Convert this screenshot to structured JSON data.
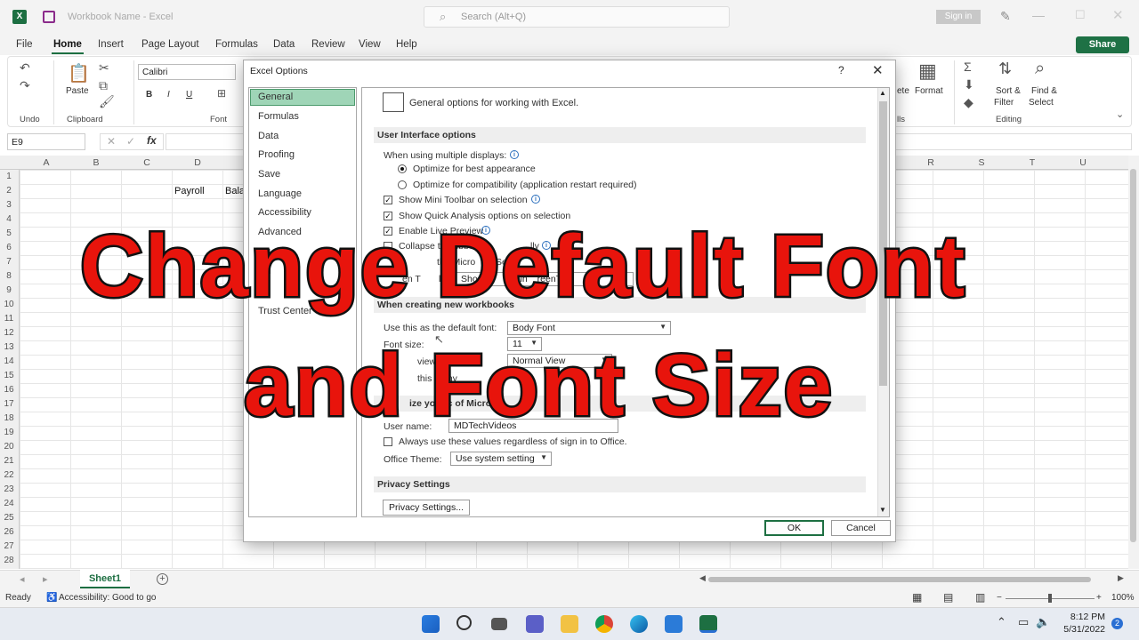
{
  "titlebar": {
    "title": "Workbook Name  -  Excel",
    "search_placeholder": "Search (Alt+Q)",
    "sign_in": "Sign in"
  },
  "menu": [
    "File",
    "Home",
    "Insert",
    "Page Layout",
    "Formulas",
    "Data",
    "Review",
    "View",
    "Help"
  ],
  "share": "Share",
  "ribbon": {
    "undo_label": "Undo",
    "clipboard_label": "Clipboard",
    "paste_label": "Paste",
    "font_label": "Font",
    "font_name": "Calibri",
    "bold": "B",
    "italic": "I",
    "underline": "U",
    "format_label": "Format",
    "sort_label": "Sort &\nFilter",
    "sort_l1": "Sort &",
    "sort_l2": "Filter",
    "find_l1": "Find &",
    "find_l2": "Select",
    "editing_label": "Editing",
    "cells_label_partial": "lls",
    "delete_partial": "ete"
  },
  "formula_bar": {
    "name_box": "E9",
    "fx": "fx"
  },
  "columns": [
    "A",
    "B",
    "C",
    "D",
    "R",
    "S",
    "T",
    "U"
  ],
  "rows": [
    "1",
    "2",
    "3",
    "4",
    "5",
    "6",
    "7",
    "8",
    "9",
    "10",
    "11",
    "12",
    "13",
    "14",
    "15",
    "16",
    "17",
    "18",
    "19",
    "20",
    "21",
    "22",
    "23",
    "24",
    "25",
    "26",
    "27",
    "28"
  ],
  "cells": {
    "payroll": "Payroll",
    "bala": "Bala"
  },
  "sheet_tab": "Sheet1",
  "status": {
    "ready": "Ready",
    "accessibility": "Accessibility: Good to go",
    "zoom": "100%"
  },
  "taskbar": {
    "time": "8:12 PM",
    "date": "5/31/2022",
    "badge": "2"
  },
  "dialog": {
    "title": "Excel Options",
    "help": "?",
    "nav": [
      "General",
      "Formulas",
      "Data",
      "Proofing",
      "Save",
      "Language",
      "Accessibility",
      "Advanced",
      "Customize Ribbon",
      "Quick Access Toolbar",
      "Add-ins",
      "Trust Center"
    ],
    "nav_visible": {
      "ribbon_partial": "Cu",
      "qat_partial": "Qu",
      "addins_partial": "A"
    },
    "header": "General options for working with Excel.",
    "sections": {
      "ui": "User Interface options",
      "new_wb": "When creating new workbooks",
      "personalize_partial": "ize your c      of Micro",
      "privacy": "Privacy Settings"
    },
    "ui": {
      "multi_displays": "When using multiple displays:",
      "opt_best": "Optimize for best appearance",
      "opt_compat": "Optimize for compatibility (application restart required)",
      "mini_toolbar": "Show Mini Toolbar on selection",
      "quick_analysis": "Show Quick Analysis options on selection",
      "live_preview": "Enable Live Preview",
      "collapse_partial": "Collapse the ribbo",
      "collapse_tail": "lly",
      "search_partial": "the Micro",
      "search_mid": "Sear",
      "search_tail": "x",
      "tip_partial": "en T",
      "tip_label_tail": "le:",
      "tip_dd_a": "Sho",
      "tip_dd_b": "ri",
      "tip_dd_c": "ns in ",
      "tip_dd_d": "reenTips"
    },
    "new_wb": {
      "default_font_label": "Use this as the default font:",
      "default_font_value": "Body Font",
      "font_size_label": "Font size:",
      "font_size_value": "11",
      "default_view_partial": "De",
      "default_view_tail": "view for n",
      "default_view_value": "Normal View",
      "sheets_partial": "this many"
    },
    "personalize": {
      "user_name_label": "User name:",
      "user_name_value": "MDTechVideos",
      "always_use": "Always use these values regardless of sign in to Office.",
      "theme_label": "Office Theme:",
      "theme_value": "Use system setting"
    },
    "privacy_button": "Privacy Settings...",
    "ok": "OK",
    "cancel": "Cancel"
  },
  "overlay": {
    "line1": "Change Default Font",
    "line2": "and Font Size"
  }
}
